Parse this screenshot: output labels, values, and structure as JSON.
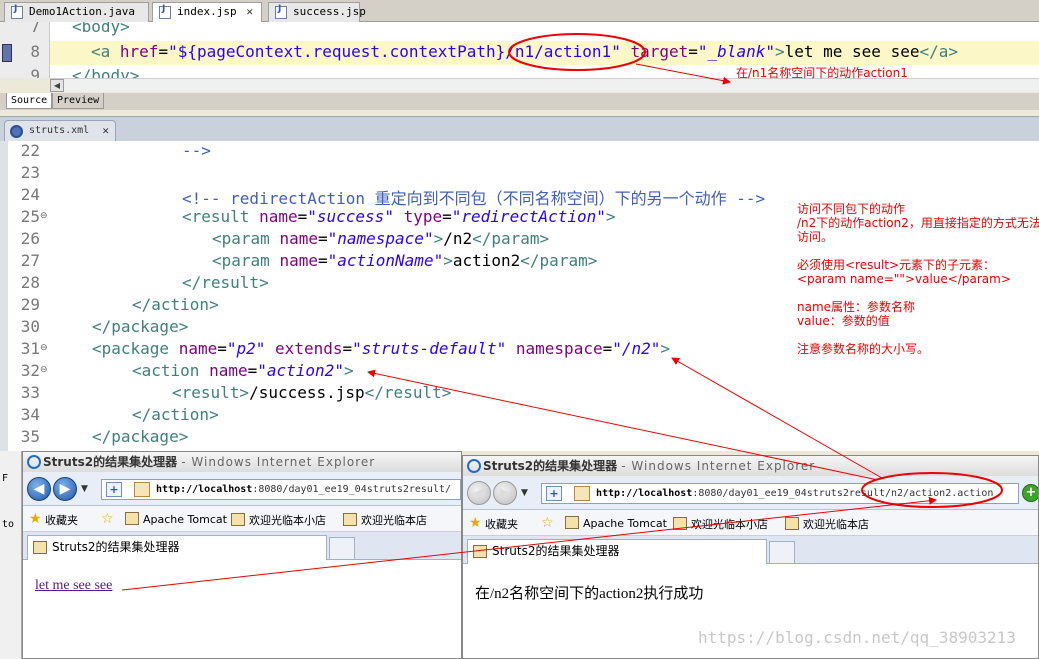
{
  "top_tabs": [
    {
      "label": "Demo1Action.java"
    },
    {
      "label": "index.jsp"
    },
    {
      "label": "success.jsp"
    }
  ],
  "jsp_editor": {
    "lines": [
      {
        "num": "7",
        "text": "<body>"
      },
      {
        "num": "8",
        "parts": {
          "open": "<a",
          "href_attr": "href",
          "eq1": "=",
          "href_val": "\"${pageContext.request.contextPath}/n1/action1\"",
          "target_attr": "target",
          "eq2": "=",
          "target_val": "\"_blank\"",
          "close": ">",
          "text": "let me see see",
          "end": "</a>"
        }
      },
      {
        "num": "9",
        "text": "</body>"
      }
    ],
    "view_tabs": [
      "Source",
      "Preview"
    ]
  },
  "annotation_top": "在/n1名称空间下的动作action1",
  "xml_tab": {
    "label": "struts.xml"
  },
  "xml_lines": [
    {
      "num": "22",
      "fold": false,
      "html_key": "l22"
    },
    {
      "num": "23",
      "fold": false
    },
    {
      "num": "24",
      "fold": false
    },
    {
      "num": "25",
      "fold": true
    },
    {
      "num": "26",
      "fold": false
    },
    {
      "num": "27",
      "fold": false
    },
    {
      "num": "28",
      "fold": false
    },
    {
      "num": "29",
      "fold": false
    },
    {
      "num": "30",
      "fold": false
    },
    {
      "num": "31",
      "fold": true
    },
    {
      "num": "32",
      "fold": true
    },
    {
      "num": "33",
      "fold": false
    },
    {
      "num": "34",
      "fold": false
    },
    {
      "num": "35",
      "fold": false
    }
  ],
  "xml_code": {
    "l22": "-->",
    "l24_comment": "<!-- redirectAction 重定向到不同包（不同名称空间）下的另一个动作 -->",
    "l25": {
      "tag": "<result",
      "a1": "name",
      "v1": "\"success\"",
      "a2": "type",
      "v2": "\"redirectAction\"",
      "end": ">"
    },
    "l26": {
      "tag": "<param",
      "a1": "name",
      "v1": "\"namespace\"",
      "gt": ">",
      "text": "/n2",
      "end": "</param>"
    },
    "l27": {
      "tag": "<param",
      "a1": "name",
      "v1": "\"actionName\"",
      "gt": ">",
      "text": "action2",
      "end": "</param>"
    },
    "l28": "</result>",
    "l29": "</action>",
    "l30": "</package>",
    "l31": {
      "tag": "<package",
      "a1": "name",
      "v1": "\"p2\"",
      "a2": "extends",
      "v2": "\"struts-default\"",
      "a3": "namespace",
      "v3": "\"/n2\"",
      "end": ">"
    },
    "l32": {
      "tag": "<action",
      "a1": "name",
      "v1": "\"action2\"",
      "end": ">"
    },
    "l33": {
      "tag": "<result>",
      "text": "/success.jsp",
      "end": "</result>"
    },
    "l34": "</action>",
    "l35": "</package>"
  },
  "side_notes": [
    "访问不同包下的动作",
    "/n2下的动作action2，用直接指定的方式无法",
    "访问。",
    "",
    "必须使用<result>元素下的子元素：",
    "<param name=\"\">value</param>",
    "",
    "name属性：参数名称",
    "value：参数的值",
    "",
    "注意参数名称的大小写。"
  ],
  "left_strip": [
    "F",
    "to"
  ],
  "ie_left": {
    "title": "Struts2的结果集处理器",
    "title_suffix": "- Windows Internet Explorer",
    "url_host": "http://localhost",
    "url_rest": ":8080/day01_ee19_04struts2result/",
    "favorites_label": "收藏夹",
    "fav_items": [
      "Apache Tomcat",
      "欢迎光临本小店",
      "欢迎光临本店"
    ],
    "tab_title": "Struts2的结果集处理器",
    "link_text": "let me see see"
  },
  "ie_right": {
    "title": "Struts2的结果集处理器",
    "title_suffix": "- Windows Internet Explorer",
    "url_host": "http://localhost",
    "url_rest": ":8080/day01_ee19_04struts2result/n2/action2.action",
    "favorites_label": "收藏夹",
    "fav_items": [
      "Apache Tomcat",
      "欢迎光临本小店",
      "欢迎光临本店"
    ],
    "tab_title": "Struts2的结果集处理器",
    "body_text": "在/n2名称空间下的action2执行成功"
  },
  "watermark": "https://blog.csdn.net/qq_38903213",
  "colors": {
    "annotation_red": "#ee0000",
    "tag": "#3f7f7f",
    "attr": "#7f007f",
    "value": "#2a00ff",
    "comment": "#3f5fbf"
  }
}
